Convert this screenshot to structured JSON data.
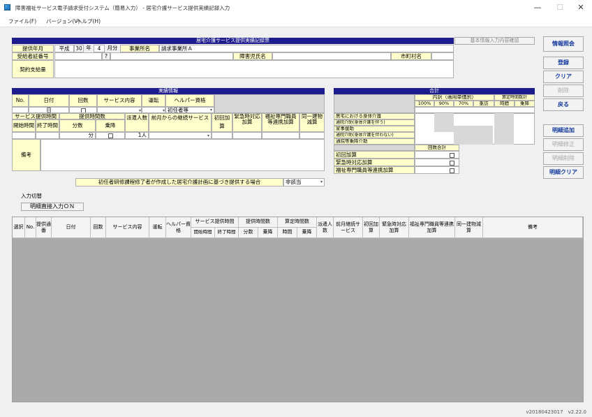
{
  "window": {
    "title": "障害福祉サービス電子請求受付システム（簡易入力） - 居宅介護サービス提供実績記録入力",
    "min": "—",
    "max": "☐",
    "close": "✕"
  },
  "menu": {
    "file": "ファイル(F)",
    "version": "バージョン(V)",
    "help": "ヘルプ(H)"
  },
  "top": {
    "banner": "居宅介護サービス提供実績記録票",
    "basic_info_btn": "基本情報入力内容確認",
    "provided_month_label": "提供年月",
    "era": "平成",
    "year": "30",
    "year_unit": "年",
    "month": "4",
    "month_unit": "月分",
    "office_label": "事業所名",
    "office_name": "請求事業所Ａ",
    "recipient_no_label": "受給者証番号",
    "question": "?",
    "child_name_label": "障害児氏名",
    "city_label": "市町村名",
    "contract_label": "契約支給量"
  },
  "side": {
    "info": "情報照会",
    "register": "登録",
    "clear": "クリア",
    "delete": "削除",
    "back": "戻る",
    "detail_add": "明細追加",
    "detail_fix": "明細修正",
    "detail_del": "明細削除",
    "detail_clear": "明細クリア"
  },
  "record": {
    "banner": "実績情報",
    "no": "No.",
    "date": "日付",
    "count": "回数",
    "service": "サービス内容",
    "driving": "運転",
    "helper": "ヘルパー資格",
    "day_suffix": "日",
    "helper_value": "初任者等",
    "svc_time": "サービス提供時間",
    "prov_time": "提供時間数",
    "dispatch": "派遣人数",
    "continued": "前月からの継続サービス",
    "first": "初回加算",
    "emergency": "緊急時対応加算",
    "welfare": "福祉専門職員等連携加算",
    "same_bldg": "同一建物減算",
    "start_time": "開始時間",
    "end_time": "終了時間",
    "minutes": "分数",
    "boarding": "乗降",
    "min_unit": "分",
    "person_count": "1",
    "person_unit": "人",
    "remarks": "備考",
    "trainee_note": "初任者研修課程修了者が作成した居宅介護計画に基づき提供する場合",
    "trainee_value": "非該当"
  },
  "totals": {
    "banner": "合計",
    "breakdown": "内訳（適用単価別）",
    "calc_hours": "算定時間数計",
    "p100": "100%",
    "p90": "90%",
    "p70": "70%",
    "severe": "重訪",
    "hours": "時間",
    "boarding": "乗降",
    "rows": [
      "居宅における身体介護",
      "通院介助(身体介護を伴う)",
      "家事援助",
      "通院介助(身体介護を伴わない)",
      "通院等乗降介助"
    ],
    "count_total": "回数合計",
    "first_add": "初回加算",
    "emergency_add": "緊急時対応加算",
    "welfare_add": "福祉専門職員等連携加算"
  },
  "switch": {
    "label": "入力切替",
    "button": "明細直接入力ＯＮ"
  },
  "grid": {
    "headers": [
      "選択",
      "No.",
      "提供通番",
      "日付",
      "回数",
      "サービス内容",
      "運転",
      "ヘルパー資格",
      "サービス提供時間",
      "提供時間数",
      "算定時間数",
      "派遣人数",
      "前月継続サービス",
      "初回加算",
      "緊急時対応加算",
      "福祉専門職員等連携加算",
      "同一建物減算",
      "備考"
    ],
    "sub_headers": [
      "開始時間",
      "終了時間",
      "分数",
      "乗降",
      "時間",
      "乗降"
    ]
  },
  "status": {
    "version": "v20180423017　v2.22.0"
  }
}
